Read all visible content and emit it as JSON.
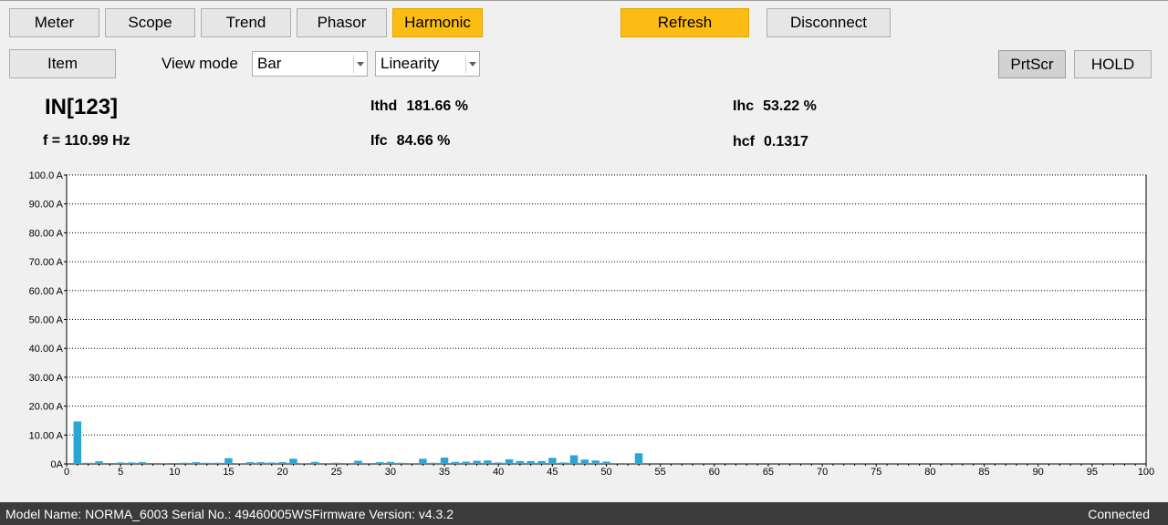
{
  "toolbar": {
    "tabs": [
      "Meter",
      "Scope",
      "Trend",
      "Phasor",
      "Harmonic"
    ],
    "active_tab": "Harmonic",
    "refresh_label": "Refresh",
    "disconnect_label": "Disconnect"
  },
  "controls": {
    "item_label": "Item",
    "view_mode_label": "View mode",
    "view_mode_value": "Bar",
    "scale_value": "Linearity",
    "prtscr_label": "PrtScr",
    "hold_label": "HOLD"
  },
  "readout": {
    "channel": "IN[123]",
    "frequency": "f = 110.99 Hz",
    "ithd_label": "Ithd",
    "ithd_value": "181.66 %",
    "ifc_label": "Ifc",
    "ifc_value": "84.66 %",
    "ihc_label": "Ihc",
    "ihc_value": "53.22 %",
    "hcf_label": "hcf",
    "hcf_value": "0.1317"
  },
  "chart_data": {
    "type": "bar",
    "xlim": [
      0,
      100
    ],
    "ylim": [
      0,
      100
    ],
    "y_tick_labels": [
      "0A",
      "10.00 A",
      "20.00 A",
      "30.00 A",
      "40.00 A",
      "50.00 A",
      "60.00 A",
      "70.00 A",
      "80.00 A",
      "90.00 A",
      "100.0 A"
    ],
    "x_tick_labels": [
      "0",
      "5",
      "10",
      "15",
      "20",
      "25",
      "30",
      "35",
      "40",
      "45",
      "50",
      "55",
      "60",
      "65",
      "70",
      "75",
      "80",
      "85",
      "90",
      "95",
      "100"
    ],
    "grid": "horizontal dotted",
    "bar_color": "#2aa6d5",
    "harmonics": [
      1,
      2,
      3,
      5,
      6,
      7,
      9,
      11,
      12,
      13,
      14,
      15,
      16,
      17,
      18,
      19,
      20,
      21,
      22,
      23,
      24,
      25,
      26,
      27,
      28,
      29,
      30,
      31,
      32,
      33,
      34,
      35,
      36,
      37,
      38,
      39,
      40,
      41,
      42,
      43,
      44,
      45,
      46,
      47,
      48,
      49,
      50,
      51,
      52,
      53
    ],
    "values": [
      14.7,
      0.4,
      0.9,
      0.5,
      0.5,
      0.6,
      0.3,
      0.4,
      0.6,
      0.4,
      0.4,
      2.0,
      0.3,
      0.6,
      0.6,
      0.5,
      0.6,
      1.8,
      0.3,
      0.7,
      0.3,
      0.4,
      0.3,
      1.1,
      0.3,
      0.6,
      0.7,
      0.4,
      0.3,
      1.8,
      0.4,
      2.2,
      0.7,
      0.8,
      1.1,
      1.2,
      0.5,
      1.6,
      1.0,
      1.0,
      1.0,
      2.1,
      0.5,
      3.0,
      1.5,
      1.2,
      0.8,
      0.3,
      0.3,
      3.7
    ]
  },
  "status": {
    "model": "Model Name:  NORMA_6003 Serial No.:  49460005WSFirmware Version:  v4.3.2",
    "connection": "Connected"
  }
}
